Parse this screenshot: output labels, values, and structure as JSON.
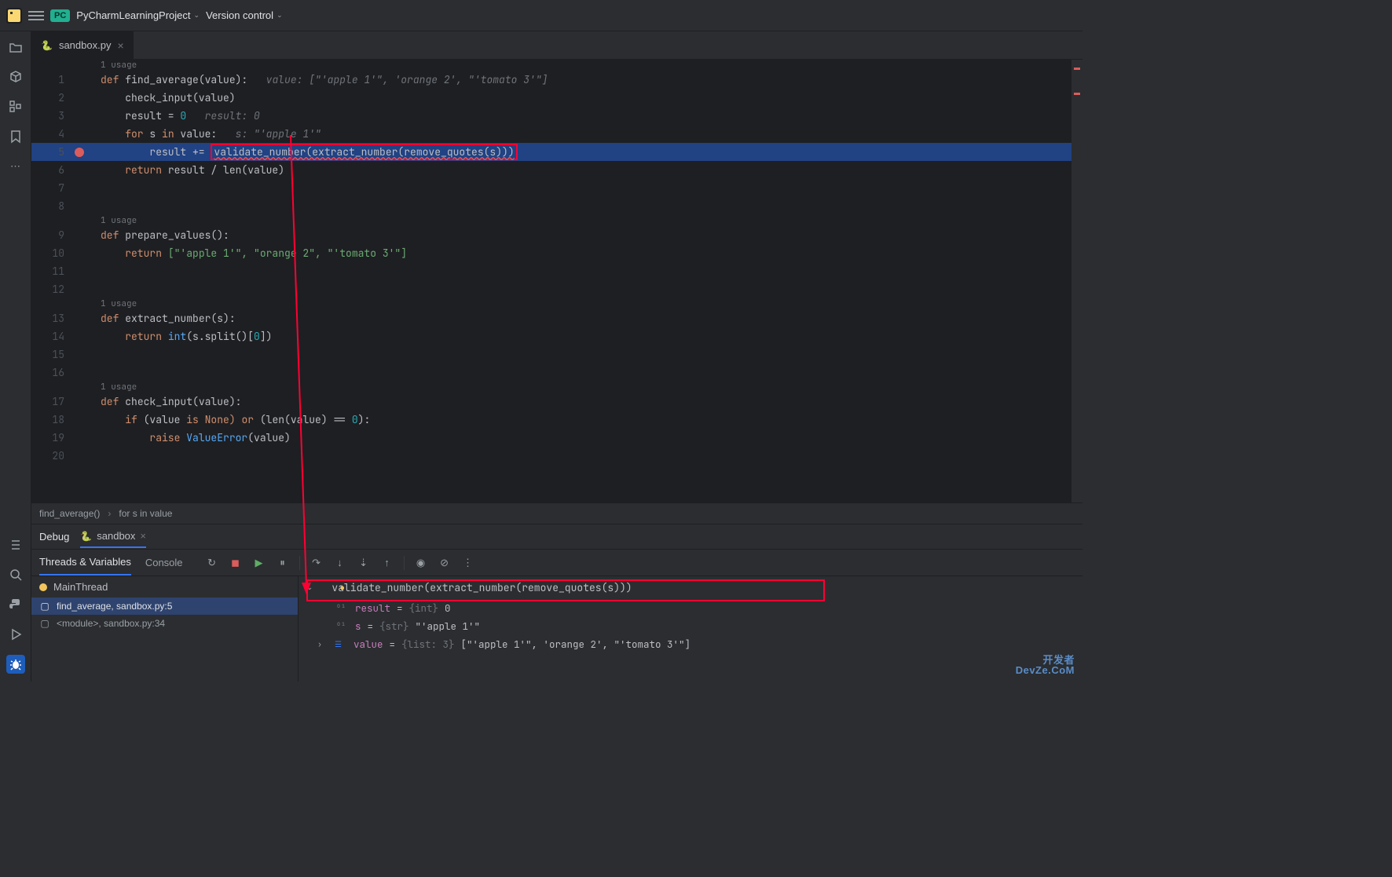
{
  "topbar": {
    "project_badge": "PC",
    "project_name": "PyCharmLearningProject",
    "version_control": "Version control"
  },
  "tab": {
    "filename": "sandbox.py"
  },
  "editor": {
    "usage_label": "1 usage",
    "lines": {
      "l1_def": "def",
      "l1_fn": "find_average",
      "l1_rest": "(value):",
      "l1_hint": "value: [\"'apple 1'\", 'orange 2', \"'tomato 3'\"]",
      "l2": "check_input(value)",
      "l3_a": "result = ",
      "l3_num": "0",
      "l3_hint": "result: 0",
      "l4_for": "for",
      "l4_in": "in",
      "l4_a": " s ",
      "l4_b": " value:",
      "l4_hint": "s: \"'apple 1'\"",
      "l5_a": "result += ",
      "l5_box": "validate_number(extract_number(remove_quotes(s)))",
      "l6_ret": "return",
      "l6_rest": " result / len(value)",
      "l9_def": "def",
      "l9_fn": "prepare_values",
      "l9_rest": "():",
      "l10_ret": "return",
      "l10_str": " [\"'apple 1'\", \"orange 2\", \"'tomato 3'\"]",
      "l13_def": "def",
      "l13_fn": "extract_number",
      "l13_rest": "(s):",
      "l14_ret": "return",
      "l14_int": " int",
      "l14_rest": "(s.split()[",
      "l14_idx": "0",
      "l14_end": "])",
      "l17_def": "def",
      "l17_fn": "check_input",
      "l17_rest": "(value):",
      "l18_if": "if",
      "l18_a": " (value ",
      "l18_is": "is",
      "l18_none": " None) ",
      "l18_or": "or",
      "l18_b": " (len(value) == ",
      "l18_zero": "0",
      "l18_end": "):",
      "l19_raise": "raise",
      "l19_err": " ValueError",
      "l19_rest": "(value)"
    },
    "line_numbers": [
      "1",
      "2",
      "3",
      "4",
      "5",
      "6",
      "7",
      "8",
      "9",
      "10",
      "11",
      "12",
      "13",
      "14",
      "15",
      "16",
      "17",
      "18",
      "19",
      "20"
    ]
  },
  "breadcrumb": {
    "parts": [
      "find_average()",
      "for s in value"
    ]
  },
  "debug": {
    "title": "Debug",
    "config_name": "sandbox",
    "tabs": {
      "threads": "Threads & Variables",
      "console": "Console"
    },
    "thread_name": "MainThread",
    "frames": [
      {
        "label": "find_average, sandbox.py:5"
      },
      {
        "label": "<module>, sandbox.py:34"
      }
    ],
    "eval_expr": "validate_number(extract_number(remove_quotes(s)))",
    "vars": {
      "result": {
        "name": "result",
        "type": "{int}",
        "value": "0"
      },
      "s": {
        "name": "s",
        "type": "{str}",
        "value": "\"'apple 1'\""
      },
      "value": {
        "name": "value",
        "type": "{list: 3}",
        "value": "[\"'apple 1'\", 'orange 2', \"'tomato 3'\"]"
      }
    }
  },
  "watermark": {
    "cn": "开发者",
    "en": "DevZe.CoM"
  }
}
